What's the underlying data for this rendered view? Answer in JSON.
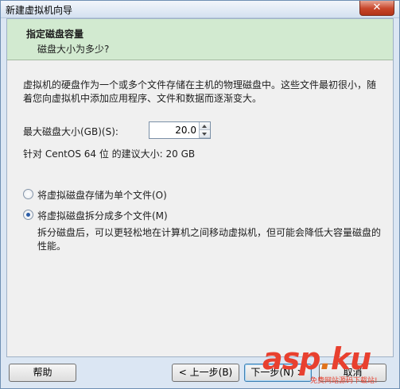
{
  "window": {
    "title": "新建虚拟机向导",
    "close_glyph": "✕"
  },
  "header": {
    "title": "指定磁盘容量",
    "subtitle": "磁盘大小为多少?"
  },
  "description": "虚拟机的硬盘作为一个或多个文件存储在主机的物理磁盘中。这些文件最初很小，随着您向虚拟机中添加应用程序、文件和数据而逐渐变大。",
  "disk_size": {
    "label": "最大磁盘大小(GB)(S):",
    "value": "20.0"
  },
  "recommend": "针对 CentOS 64 位 的建议大小: 20 GB",
  "options": [
    {
      "label": "将虚拟磁盘存储为单个文件(O)",
      "selected": false
    },
    {
      "label": "将虚拟磁盘拆分成多个文件(M)",
      "selected": true
    }
  ],
  "option_desc": "拆分磁盘后，可以更轻松地在计算机之间移动虚拟机，但可能会降低大容量磁盘的性能。",
  "buttons": {
    "help": "帮助",
    "back": "< 上一步(B)",
    "next": "下一步(N) >",
    "cancel": "取消"
  },
  "watermark": {
    "brand_a": "asp",
    "brand_b": "ku",
    "tagline": "免费网站源码下载站!"
  }
}
